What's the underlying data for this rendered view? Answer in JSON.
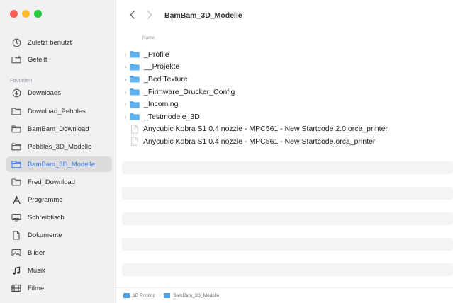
{
  "sidebar": {
    "items": [
      {
        "label": "Zuletzt benutzt",
        "icon": "clock-icon"
      },
      {
        "label": "Geteilt",
        "icon": "shared-folder-icon"
      }
    ],
    "favorites_label": "Favoriten",
    "favorites": [
      {
        "label": "Downloads",
        "icon": "download-icon"
      },
      {
        "label": "Download_Pebbles",
        "icon": "folder-icon"
      },
      {
        "label": "BamBam_Download",
        "icon": "folder-icon"
      },
      {
        "label": "Pebbles_3D_Modelle",
        "icon": "folder-icon"
      },
      {
        "label": "BamBam_3D_Modelle",
        "icon": "folder-icon",
        "selected": true
      },
      {
        "label": "Fred_Download",
        "icon": "folder-icon"
      },
      {
        "label": "Programme",
        "icon": "apps-icon"
      },
      {
        "label": "Schreibtisch",
        "icon": "desktop-icon"
      },
      {
        "label": "Dokumente",
        "icon": "document-icon"
      },
      {
        "label": "Bilder",
        "icon": "photo-icon"
      },
      {
        "label": "Musik",
        "icon": "music-icon"
      },
      {
        "label": "Filme",
        "icon": "film-icon"
      }
    ]
  },
  "toolbar": {
    "title": "BamBam_3D_Modelle"
  },
  "list": {
    "column_name": "Name",
    "rows": [
      {
        "name": "_Profile",
        "type": "folder"
      },
      {
        "name": "__Projekte",
        "type": "folder"
      },
      {
        "name": "_Bed Texture",
        "type": "folder"
      },
      {
        "name": "_Firmware_Drucker_Config",
        "type": "folder"
      },
      {
        "name": "_Incoming",
        "type": "folder"
      },
      {
        "name": "_Testmodele_3D",
        "type": "folder"
      },
      {
        "name": "Anycubic Kobra S1 0.4 nozzle - MPC561 - New Startcode 2.0.orca_printer",
        "type": "file"
      },
      {
        "name": "Anycubic Kobra S1 0.4 nozzle - MPC561 - New Startcode.orca_printer",
        "type": "file"
      }
    ]
  },
  "pathbar": {
    "segments": [
      "3D Printing",
      "BamBam_3D_Modelle"
    ]
  },
  "colors": {
    "accent": "#3b7cf5",
    "folder": "#4aa3e8"
  }
}
